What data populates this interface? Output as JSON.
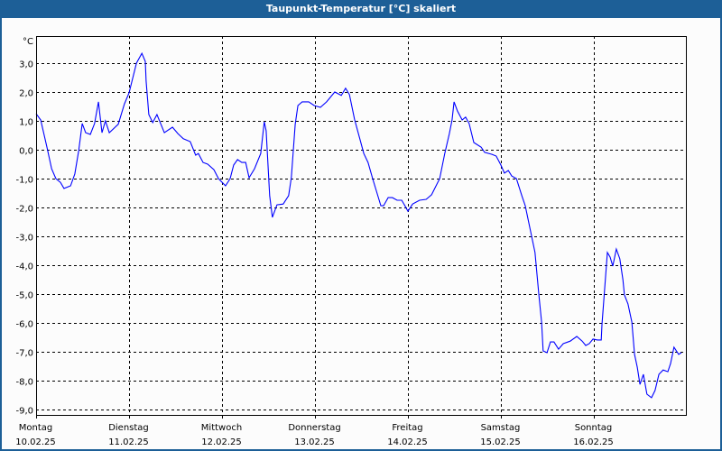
{
  "window": {
    "title": "Taupunkt-Temperatur [°C] skaliert"
  },
  "colors": {
    "titlebar": "#1d5f97",
    "line": "#0000ff",
    "grid": "#000000"
  },
  "chart_data": {
    "type": "line",
    "title": "Taupunkt-Temperatur [°C] skaliert",
    "ylabel": "°C",
    "ylim": [
      -9.2,
      3.95
    ],
    "xlim_hours": [
      0,
      168
    ],
    "yticks": [
      3,
      2,
      1,
      0,
      -1,
      -2,
      -3,
      -4,
      -5,
      -6,
      -7,
      -8,
      -9
    ],
    "ytick_labels": [
      "3,0",
      "2,0",
      "1,0",
      "0,0",
      "-1,0",
      "-2,0",
      "-3,0",
      "-4,0",
      "-5,0",
      "-6,0",
      "-7,0",
      "-8,0",
      "-9,0"
    ],
    "grid": true,
    "xticks": [
      {
        "day": "Montag",
        "date": "10.02.25"
      },
      {
        "day": "Dienstag",
        "date": "11.02.25"
      },
      {
        "day": "Mittwoch",
        "date": "12.02.25"
      },
      {
        "day": "Donnerstag",
        "date": "13.02.25"
      },
      {
        "day": "Freitag",
        "date": "14.02.25"
      },
      {
        "day": "Samstag",
        "date": "15.02.25"
      },
      {
        "day": "Sonntag",
        "date": "16.02.25"
      }
    ],
    "series": [
      {
        "name": "Taupunkt",
        "points_hours_value": [
          [
            0.0,
            1.25
          ],
          [
            1.2,
            1.03
          ],
          [
            2.8,
            0.09
          ],
          [
            4.0,
            -0.66
          ],
          [
            5.1,
            -1.0
          ],
          [
            6.3,
            -1.13
          ],
          [
            7.2,
            -1.34
          ],
          [
            8.9,
            -1.25
          ],
          [
            10.0,
            -0.84
          ],
          [
            11.0,
            -0.03
          ],
          [
            11.9,
            0.91
          ],
          [
            12.8,
            0.59
          ],
          [
            14.0,
            0.53
          ],
          [
            15.1,
            0.91
          ],
          [
            16.1,
            1.66
          ],
          [
            17.0,
            0.59
          ],
          [
            17.9,
            1.0
          ],
          [
            18.9,
            0.59
          ],
          [
            21.2,
            0.88
          ],
          [
            22.8,
            1.59
          ],
          [
            24.0,
            1.97
          ],
          [
            25.9,
            3.0
          ],
          [
            27.3,
            3.34
          ],
          [
            28.2,
            3.06
          ],
          [
            28.4,
            2.38
          ],
          [
            29.1,
            1.22
          ],
          [
            30.1,
            0.94
          ],
          [
            31.2,
            1.22
          ],
          [
            33.1,
            0.59
          ],
          [
            35.2,
            0.78
          ],
          [
            36.6,
            0.56
          ],
          [
            38.0,
            0.38
          ],
          [
            39.8,
            0.28
          ],
          [
            41.2,
            -0.19
          ],
          [
            41.9,
            -0.13
          ],
          [
            43.1,
            -0.44
          ],
          [
            44.3,
            -0.5
          ],
          [
            45.9,
            -0.69
          ],
          [
            47.1,
            -1.0
          ],
          [
            48.9,
            -1.25
          ],
          [
            50.1,
            -1.0
          ],
          [
            51.0,
            -0.53
          ],
          [
            52.0,
            -0.34
          ],
          [
            53.1,
            -0.44
          ],
          [
            54.1,
            -0.44
          ],
          [
            55.0,
            -0.97
          ],
          [
            56.4,
            -0.66
          ],
          [
            58.0,
            -0.13
          ],
          [
            58.9,
            0.97
          ],
          [
            59.4,
            0.66
          ],
          [
            60.3,
            -1.59
          ],
          [
            61.0,
            -2.34
          ],
          [
            62.2,
            -1.91
          ],
          [
            63.8,
            -1.88
          ],
          [
            65.2,
            -1.59
          ],
          [
            65.9,
            -0.97
          ],
          [
            66.9,
            0.88
          ],
          [
            67.6,
            1.53
          ],
          [
            68.7,
            1.66
          ],
          [
            70.4,
            1.66
          ],
          [
            71.8,
            1.53
          ],
          [
            73.4,
            1.47
          ],
          [
            75.0,
            1.66
          ],
          [
            77.1,
            2.0
          ],
          [
            78.8,
            1.88
          ],
          [
            79.9,
            2.13
          ],
          [
            80.9,
            1.91
          ],
          [
            82.2,
            1.06
          ],
          [
            84.6,
            -0.13
          ],
          [
            85.7,
            -0.44
          ],
          [
            86.9,
            -1.0
          ],
          [
            89.0,
            -1.94
          ],
          [
            89.7,
            -1.94
          ],
          [
            90.9,
            -1.66
          ],
          [
            92.0,
            -1.66
          ],
          [
            93.2,
            -1.75
          ],
          [
            94.4,
            -1.75
          ],
          [
            95.1,
            -1.91
          ],
          [
            96.0,
            -2.13
          ],
          [
            97.2,
            -1.88
          ],
          [
            99.0,
            -1.75
          ],
          [
            100.7,
            -1.72
          ],
          [
            102.1,
            -1.56
          ],
          [
            104.2,
            -1.0
          ],
          [
            105.5,
            -0.13
          ],
          [
            106.7,
            0.56
          ],
          [
            107.4,
            1.03
          ],
          [
            107.9,
            1.66
          ],
          [
            108.8,
            1.34
          ],
          [
            110.0,
            1.03
          ],
          [
            110.9,
            1.13
          ],
          [
            111.8,
            0.91
          ],
          [
            113.0,
            0.25
          ],
          [
            114.9,
            0.09
          ],
          [
            115.8,
            -0.09
          ],
          [
            117.7,
            -0.16
          ],
          [
            118.8,
            -0.22
          ],
          [
            120.0,
            -0.53
          ],
          [
            120.9,
            -0.81
          ],
          [
            121.9,
            -0.72
          ],
          [
            122.8,
            -0.91
          ],
          [
            124.0,
            -1.0
          ],
          [
            125.4,
            -1.59
          ],
          [
            126.3,
            -1.94
          ],
          [
            127.7,
            -2.84
          ],
          [
            128.8,
            -3.56
          ],
          [
            129.3,
            -4.28
          ],
          [
            129.8,
            -5.03
          ],
          [
            130.5,
            -5.97
          ],
          [
            130.9,
            -6.97
          ],
          [
            131.9,
            -7.03
          ],
          [
            132.8,
            -6.66
          ],
          [
            133.7,
            -6.66
          ],
          [
            134.9,
            -6.91
          ],
          [
            136.1,
            -6.72
          ],
          [
            137.9,
            -6.63
          ],
          [
            139.6,
            -6.47
          ],
          [
            141.0,
            -6.63
          ],
          [
            141.9,
            -6.78
          ],
          [
            142.8,
            -6.72
          ],
          [
            143.8,
            -6.56
          ],
          [
            144.9,
            -6.59
          ],
          [
            145.9,
            -6.59
          ],
          [
            146.1,
            -6.06
          ],
          [
            146.8,
            -4.81
          ],
          [
            147.5,
            -3.56
          ],
          [
            148.2,
            -3.72
          ],
          [
            148.9,
            -4.03
          ],
          [
            149.8,
            -3.44
          ],
          [
            150.7,
            -3.78
          ],
          [
            151.5,
            -4.5
          ],
          [
            151.9,
            -5.03
          ],
          [
            152.8,
            -5.34
          ],
          [
            153.8,
            -5.97
          ],
          [
            154.5,
            -7.09
          ],
          [
            155.2,
            -7.53
          ],
          [
            155.9,
            -8.13
          ],
          [
            156.8,
            -7.78
          ],
          [
            157.7,
            -8.47
          ],
          [
            158.9,
            -8.59
          ],
          [
            159.8,
            -8.34
          ],
          [
            160.8,
            -7.78
          ],
          [
            161.9,
            -7.63
          ],
          [
            163.1,
            -7.69
          ],
          [
            163.8,
            -7.41
          ],
          [
            164.7,
            -6.84
          ],
          [
            165.9,
            -7.09
          ],
          [
            166.6,
            -7.03
          ]
        ]
      }
    ]
  }
}
